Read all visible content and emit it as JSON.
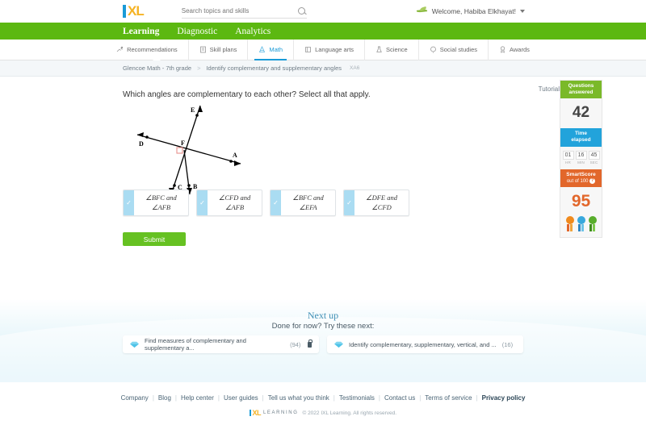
{
  "header": {
    "logo_text": "XL",
    "search": {
      "placeholder": "Search topics and skills",
      "value": ""
    },
    "welcome": "Welcome, Habiba Elkhayat!"
  },
  "mainnav": [
    {
      "label": "Learning",
      "active": true
    },
    {
      "label": "Diagnostic",
      "active": false
    },
    {
      "label": "Analytics",
      "active": false
    }
  ],
  "subnav": [
    {
      "label": "Recommendations",
      "icon": "recommendations-icon",
      "active": false
    },
    {
      "label": "Skill plans",
      "icon": "skill-plans-icon",
      "active": false
    },
    {
      "label": "Math",
      "icon": "math-icon",
      "active": true
    },
    {
      "label": "Language arts",
      "icon": "language-arts-icon",
      "active": false
    },
    {
      "label": "Science",
      "icon": "science-icon",
      "active": false
    },
    {
      "label": "Social studies",
      "icon": "social-studies-icon",
      "active": false
    },
    {
      "label": "Awards",
      "icon": "awards-icon",
      "active": false
    }
  ],
  "breadcrumb": {
    "course": "Glencoe Math - 7th grade",
    "separator": ">",
    "skill": "Identify complementary and supplementary angles",
    "skill_code": "XA6"
  },
  "question": {
    "prompt": "Which angles are complementary to each other? Select all that apply.",
    "figure": {
      "labels": [
        "E",
        "D",
        "F",
        "A",
        "C",
        "B"
      ],
      "right_angle_marker": true,
      "marker_color": "#e8918c"
    },
    "choices": [
      {
        "line1": "∠BFC and",
        "line2": "∠AFB"
      },
      {
        "line1": "∠CFD and",
        "line2": "∠AFB"
      },
      {
        "line1": "∠BFC and",
        "line2": "∠EFA"
      },
      {
        "line1": "∠DFE and",
        "line2": "∠CFD"
      }
    ],
    "submit_label": "Submit"
  },
  "sidebar": {
    "tutorial_label": "Tutorial",
    "questions_answered": {
      "title_line1": "Questions",
      "title_line2": "answered",
      "value": "42"
    },
    "time_elapsed": {
      "title_line1": "Time",
      "title_line2": "elapsed",
      "hr": "01",
      "min": "16",
      "sec": "45",
      "hr_label": "HR",
      "min_label": "MIN",
      "sec_label": "SEC"
    },
    "smartscore": {
      "title": "SmartScore",
      "subtitle": "out of 100",
      "value": "95"
    },
    "ribbon_colors": [
      "#f08a1d",
      "#38a8dd",
      "#58ad2c"
    ]
  },
  "nextup": {
    "title": "Next up",
    "subtitle": "Done for now? Try these next:",
    "cards": [
      {
        "label": "Find measures of complementary and supplementary a...",
        "count": "(94)",
        "locked": true
      },
      {
        "label": "Identify complementary, supplementary, vertical, and ...",
        "count": "(16)",
        "locked": false
      }
    ]
  },
  "footer": {
    "links": [
      "Company",
      "Blog",
      "Help center",
      "User guides",
      "Tell us what you think",
      "Testimonials",
      "Contact us",
      "Terms of service",
      "Privacy policy"
    ],
    "logo_word": "LEARNING",
    "copyright": "© 2022 IXL Learning. All rights reserved."
  },
  "colors": {
    "brand_green": "#5cb811",
    "brand_blue": "#1a9bd7",
    "brand_yellow": "#f5b324",
    "accent_orange": "#e2672b"
  }
}
